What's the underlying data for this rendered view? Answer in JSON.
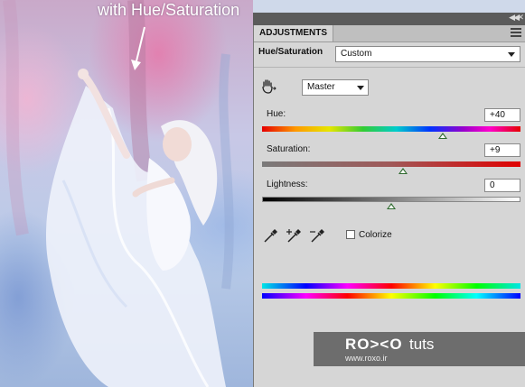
{
  "photo": {
    "caption": "with Hue/Saturation"
  },
  "panel": {
    "tab_label": "ADJUSTMENTS",
    "adjustment_title": "Hue/Saturation",
    "preset_value": "Custom",
    "channel_value": "Master",
    "hue": {
      "label": "Hue:",
      "value": "+40",
      "fraction": 0.7
    },
    "saturation": {
      "label": "Saturation:",
      "value": "+9",
      "fraction": 0.545
    },
    "lightness": {
      "label": "Lightness:",
      "value": "0",
      "fraction": 0.5
    },
    "colorize_label": "Colorize",
    "colorize_checked": false
  },
  "watermark": {
    "logo": "RO><O",
    "suffix": "tuts",
    "url": "www.roxo.ir"
  },
  "icons": [
    "hand-tool-icon",
    "eyedropper-icon",
    "eyedropper-plus-icon",
    "eyedropper-minus-icon",
    "chevron-down-icon",
    "panel-menu-icon",
    "collapse-icon",
    "close-icon",
    "arrow-icon"
  ]
}
